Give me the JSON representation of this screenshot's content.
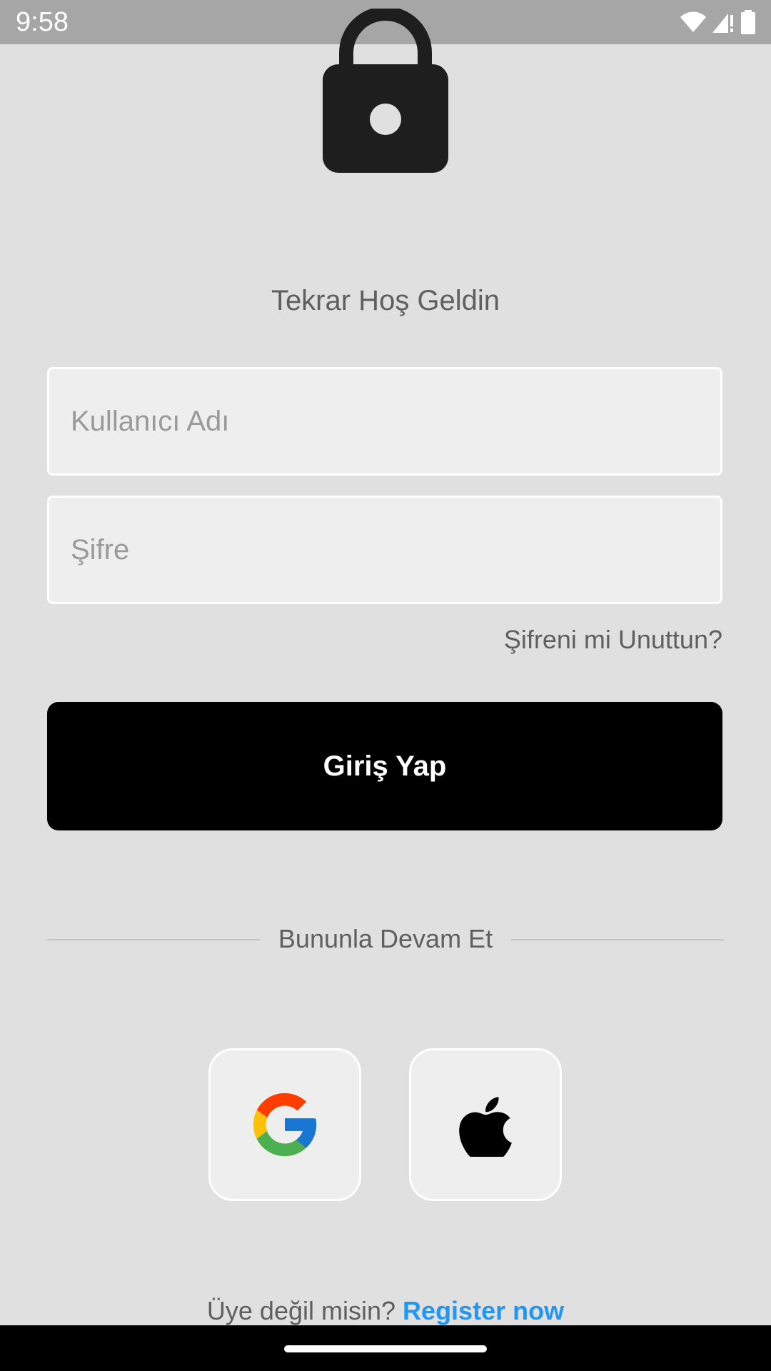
{
  "status_bar": {
    "time": "9:58",
    "icons": [
      "wifi-icon",
      "signal-icon",
      "battery-icon"
    ]
  },
  "app": {
    "icon": "lock-icon",
    "welcome": "Tekrar Hoş Geldin",
    "username": {
      "placeholder": "Kullanıcı Adı",
      "value": ""
    },
    "password": {
      "placeholder": "Şifre",
      "value": ""
    },
    "forgot_password": "Şifreni mi Unuttun?",
    "login_button": "Giriş Yap",
    "divider_text": "Bununla Devam Et",
    "social": [
      {
        "name": "google",
        "icon": "google-icon"
      },
      {
        "name": "apple",
        "icon": "apple-icon"
      }
    ],
    "register_prompt": "Üye değil misin?",
    "register_link": "Register now"
  },
  "colors": {
    "accent": "#2196f3",
    "button": "#000000",
    "background": "#e0e0e0"
  }
}
